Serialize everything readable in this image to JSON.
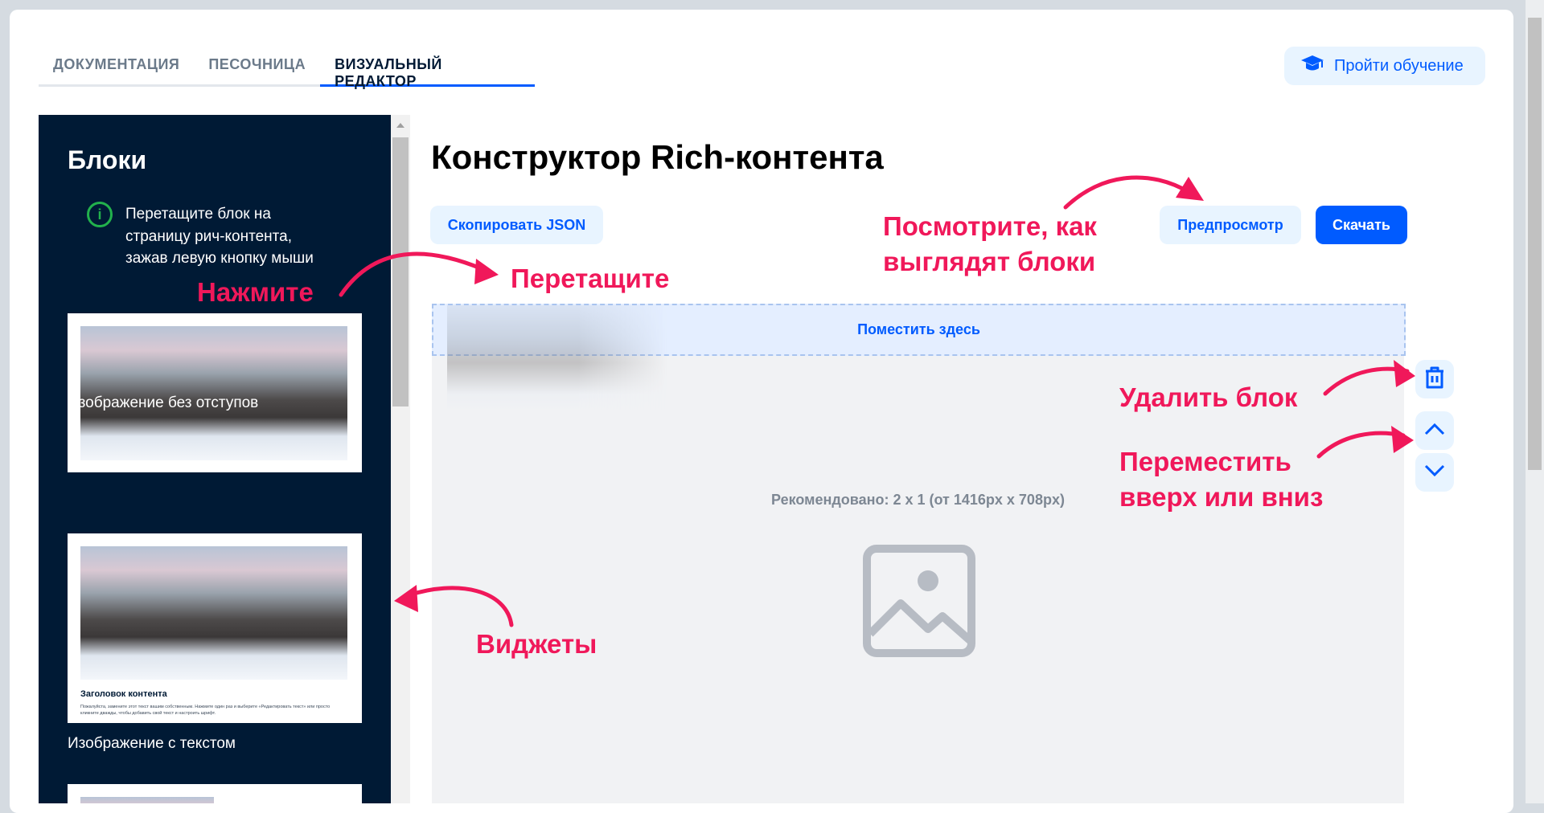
{
  "tabs": [
    {
      "label": "ДОКУМЕНТАЦИЯ"
    },
    {
      "label": "ПЕСОЧНИЦА"
    },
    {
      "label": "ВИЗУАЛЬНЫЙ РЕДАКТОР",
      "active": true
    }
  ],
  "learn_button": "Пройти обучение",
  "sidebar": {
    "title": "Блоки",
    "hint": "Перетащите блок на страницу рич-контента, зажав левую кнопку мыши",
    "blocks": [
      {
        "label": "Изображение без отступов"
      },
      {
        "label": "Изображение с текстом",
        "preview_title": "Заголовок контента",
        "preview_text": "Пожалуйста, замените этот текст вашим собственным. Нажмите один раз и выберите «Редактировать текст» или просто кликните дважды, чтобы добавить свой текст и настроить шрифт."
      }
    ]
  },
  "main": {
    "title": "Конструктор Rich-контента",
    "copy_json": "Скопировать JSON",
    "preview": "Предпросмотр",
    "download": "Скачать",
    "drop_zone": "Поместить здесь",
    "recommended": "Рекомендовано: 2 x 1 (от 1416px x 708px)"
  },
  "annotations": {
    "click": "Нажмите",
    "drag": "Перетащите",
    "preview_1": "Посмотрите, как",
    "preview_2": "выглядят блоки",
    "delete": "Удалить блок",
    "move_1": "Переместить",
    "move_2": "вверх или вниз",
    "widgets": "Виджеты"
  },
  "colors": {
    "accent": "#005bff",
    "sidebar": "#001a35",
    "annotation": "#f0185a"
  }
}
